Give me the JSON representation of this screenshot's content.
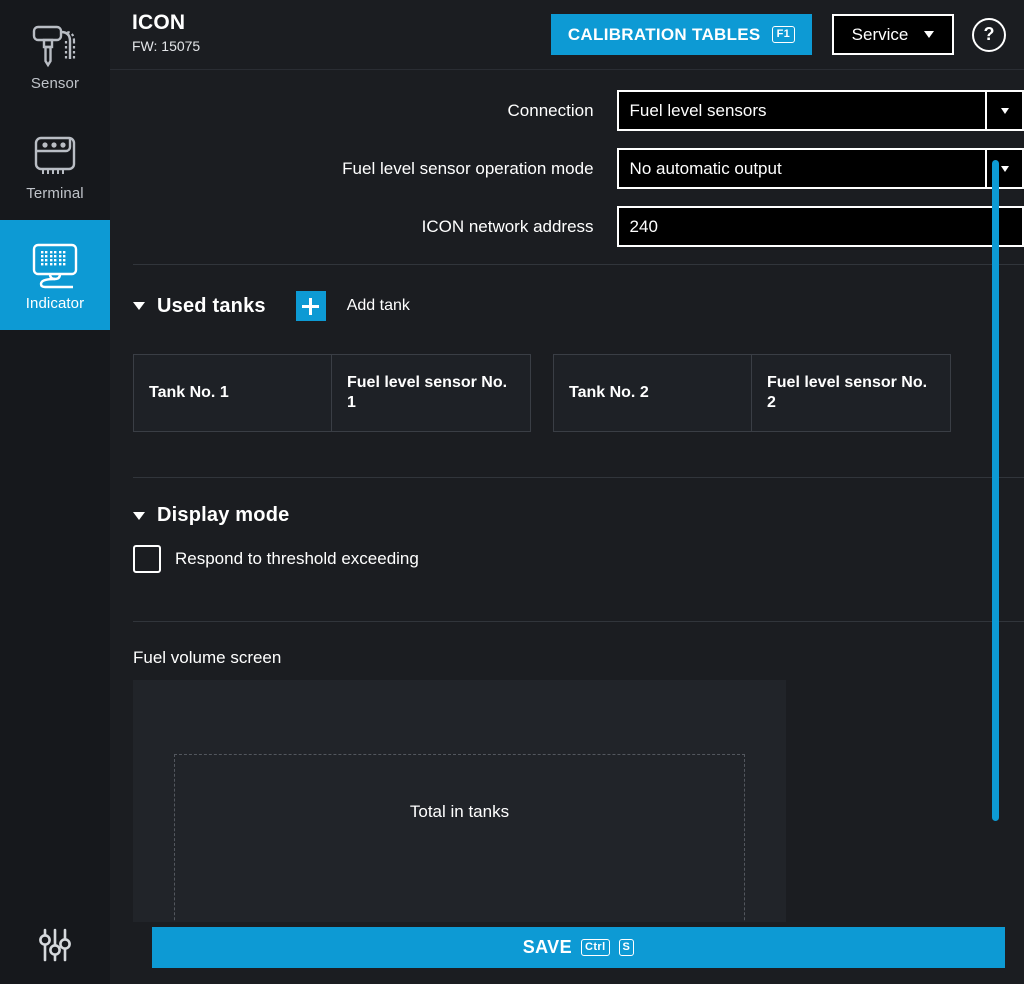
{
  "sidebar": {
    "items": [
      {
        "label": "Sensor",
        "icon": "sensor-probe-icon",
        "active": false
      },
      {
        "label": "Terminal",
        "icon": "terminal-device-icon",
        "active": false
      },
      {
        "label": "Indicator",
        "icon": "indicator-display-icon",
        "active": true
      }
    ],
    "bottom": {
      "icon": "sliders-settings-icon"
    },
    "active_color": "#0d9ad4"
  },
  "header": {
    "title": "ICON",
    "firmware": "FW: 15075",
    "calibration_button": {
      "label": "CALIBRATION TABLES",
      "shortcut": "F1"
    },
    "service_select": {
      "value": "Service",
      "icon": "chevron-down-icon"
    },
    "help_button": {
      "label": "?",
      "icon": "question-mark-icon"
    }
  },
  "form": {
    "rows": [
      {
        "label": "Connection",
        "value": "Fuel level sensors",
        "type": "select",
        "has_indicator": true,
        "indicator_color": "#e07c10"
      },
      {
        "label": "Fuel level sensor operation mode",
        "value": "No automatic output",
        "type": "select",
        "has_indicator": true,
        "indicator_color": "#e07c10"
      },
      {
        "label": "ICON network address",
        "value": "240",
        "type": "text",
        "has_indicator": false,
        "indicator_color": ""
      }
    ]
  },
  "used_tanks": {
    "title": "Used tanks",
    "expanded": true,
    "add_label": "Add tank",
    "tanks": [
      {
        "name": "Tank No. 1",
        "sensor": "Fuel level sensor No. 1"
      },
      {
        "name": "Tank No. 2",
        "sensor": "Fuel level sensor No. 2"
      }
    ]
  },
  "display_mode": {
    "title": "Display mode",
    "expanded": true,
    "checkbox": {
      "label": "Respond to threshold exceeding",
      "checked": false
    }
  },
  "fuel_volume_screen": {
    "title": "Fuel volume screen",
    "placeholder_label": "Total in tanks"
  },
  "footer": {
    "save_label": "SAVE",
    "shortcut_mod": "Ctrl",
    "shortcut_key": "S"
  },
  "scrollbar": {
    "color": "#0d9ad4"
  }
}
